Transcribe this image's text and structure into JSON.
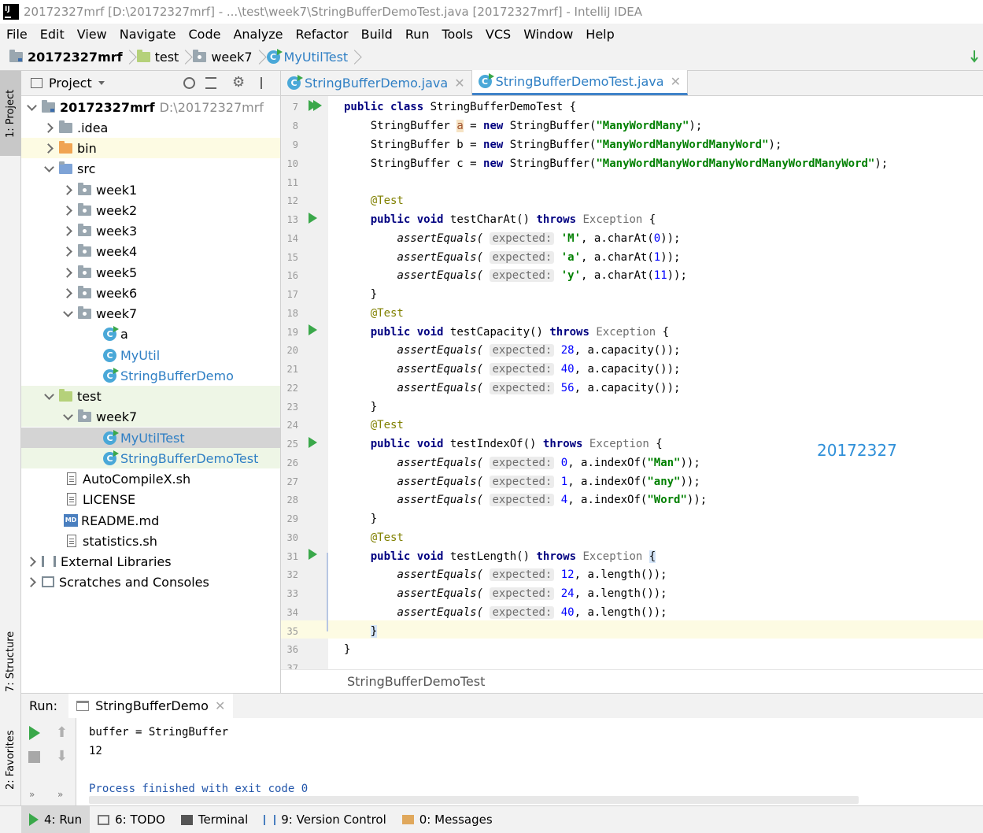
{
  "window": {
    "title": "20172327mrf [D:\\20172327mrf] - ...\\test\\week7\\StringBufferDemoTest.java [20172327mrf] - IntelliJ IDEA"
  },
  "menu": [
    "File",
    "Edit",
    "View",
    "Navigate",
    "Code",
    "Analyze",
    "Refactor",
    "Build",
    "Run",
    "Tools",
    "VCS",
    "Window",
    "Help"
  ],
  "breadcrumb": [
    "20172327mrf",
    "test",
    "week7",
    "MyUtilTest"
  ],
  "left_strip": {
    "project": "1: Project",
    "structure": "7: Structure",
    "favorites": "2: Favorites"
  },
  "project_panel": {
    "title": "Project",
    "root_name": "20172327mrf",
    "root_path": "D:\\20172327mrf",
    "items": {
      "idea": ".idea",
      "bin": "bin",
      "src": "src",
      "week1": "week1",
      "week2": "week2",
      "week3": "week3",
      "week4": "week4",
      "week5": "week5",
      "week6": "week6",
      "week7": "week7",
      "a": "a",
      "myutil": "MyUtil",
      "sbdemo": "StringBufferDemo",
      "test": "test",
      "test_week7": "week7",
      "myutiltest": "MyUtilTest",
      "sbdemotest": "StringBufferDemoTest",
      "autocompile": "AutoCompileX.sh",
      "license": "LICENSE",
      "readme": "README.md",
      "statistics": "statistics.sh",
      "extlibs": "External Libraries",
      "scratches": "Scratches and Consoles"
    },
    "md_badge": "MD"
  },
  "editor": {
    "tabs": [
      "StringBufferDemo.java",
      "StringBufferDemoTest.java"
    ],
    "line_numbers": [
      "7",
      "8",
      "9",
      "10",
      "11",
      "12",
      "13",
      "14",
      "15",
      "16",
      "17",
      "18",
      "19",
      "20",
      "21",
      "22",
      "23",
      "24",
      "25",
      "26",
      "27",
      "28",
      "29",
      "30",
      "31",
      "32",
      "33",
      "34",
      "35",
      "36",
      "37"
    ],
    "watermark": "20172327",
    "footer": "StringBufferDemoTest",
    "tokens": {
      "public": "public",
      "class": "class",
      "classname": "StringBufferDemoTest {",
      "sb": "StringBuffer",
      "new": "new",
      "void": "void",
      "throws": "throws",
      "exception": "Exception",
      "test": "@Test",
      "assert": "assertEquals(",
      "expected": "expected:",
      "s1": "\"ManyWordMany\"",
      "s2": "\"ManyWordManyWordManyWord\"",
      "s3": "\"ManyWordManyWordManyWordManyWordManyWord\"",
      "m1": "testCharAt()",
      "m2": "testCapacity()",
      "m3": "testIndexOf()",
      "m4": "testLength()",
      "cM": "'M'",
      "ca": "'a'",
      "cy": "'y'",
      "n0": "0",
      "n1": "1",
      "n11": "11",
      "n28": "28",
      "n40": "40",
      "n56": "56",
      "n4": "4",
      "n12": "12",
      "n24": "24",
      "sMan": "\"Man\"",
      "sany": "\"any\"",
      "sWord": "\"Word\""
    }
  },
  "run": {
    "label": "Run:",
    "tab": "StringBufferDemo",
    "console": [
      "buffer = StringBuffer",
      "12",
      "",
      "Process finished with exit code 0"
    ]
  },
  "statusbar": {
    "run": "4: Run",
    "todo": "6: TODO",
    "terminal": "Terminal",
    "vcs": "9: Version Control",
    "messages": "0: Messages"
  },
  "colors": {
    "accent": "#4083c9",
    "run_green": "#3aa84a",
    "watermark": "#2f8fd8"
  }
}
